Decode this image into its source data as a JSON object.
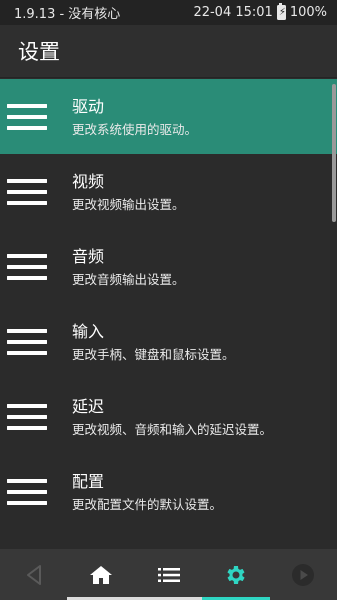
{
  "status": {
    "left": "1.9.13 - 没有核心",
    "datetime": "22-04 15:01",
    "battery": "100%"
  },
  "header": {
    "title": "设置"
  },
  "items": [
    {
      "title": "驱动",
      "desc": "更改系统使用的驱动。"
    },
    {
      "title": "视频",
      "desc": "更改视频输出设置。"
    },
    {
      "title": "音频",
      "desc": "更改音频输出设置。"
    },
    {
      "title": "输入",
      "desc": "更改手柄、键盘和鼠标设置。"
    },
    {
      "title": "延迟",
      "desc": "更改视频、音频和输入的延迟设置。"
    },
    {
      "title": "配置",
      "desc": "更改配置文件的默认设置。"
    }
  ],
  "nav": {
    "items": [
      {
        "icon": "back-icon",
        "active": false
      },
      {
        "icon": "home-icon",
        "active": false
      },
      {
        "icon": "list-icon",
        "active": false
      },
      {
        "icon": "settings-gear-icon",
        "active": true
      },
      {
        "icon": "play-icon",
        "active": false
      }
    ]
  },
  "colors": {
    "selected": "#2a8c77",
    "accent": "#2fd6c3",
    "background": "#2b2b2b",
    "nav_background": "#383838"
  }
}
